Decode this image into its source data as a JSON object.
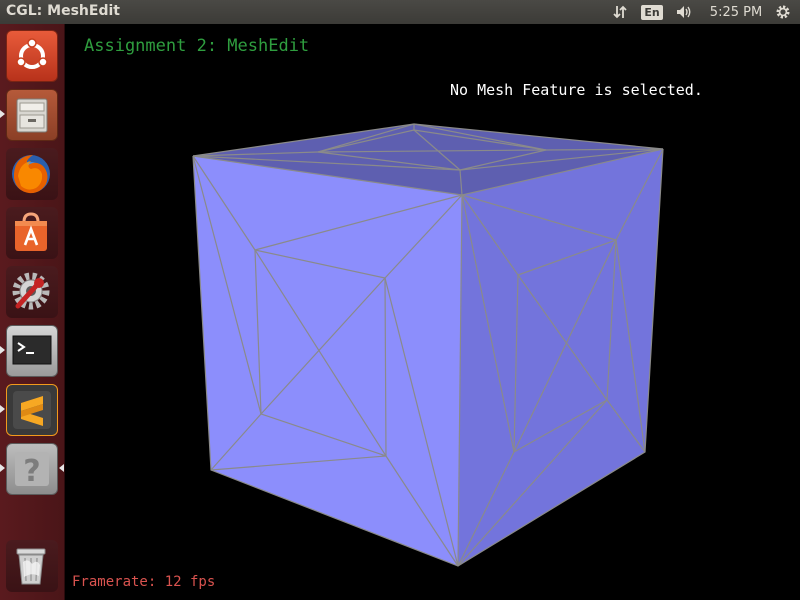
{
  "window": {
    "title": "CGL: MeshEdit"
  },
  "tray": {
    "network_icon": "network-transfer-icon",
    "language": "En",
    "volume_icon": "volume-icon",
    "clock": "5:25 PM",
    "settings_icon": "gear-icon"
  },
  "launcher": {
    "items": [
      {
        "name": "ubuntu-dash",
        "icon": "ubuntu-logo-icon",
        "running": false
      },
      {
        "name": "files",
        "icon": "file-cabinet-icon",
        "running": true
      },
      {
        "name": "firefox",
        "icon": "firefox-icon",
        "running": false
      },
      {
        "name": "software-center",
        "icon": "shopping-bag-icon",
        "running": false
      },
      {
        "name": "system-settings",
        "icon": "wrench-gear-icon",
        "running": false
      },
      {
        "name": "terminal",
        "icon": "terminal-icon",
        "running": true,
        "prompt": ">_"
      },
      {
        "name": "sublime-text",
        "icon": "sublime-icon",
        "running": true,
        "glyph": "S"
      },
      {
        "name": "unknown-app",
        "icon": "question-icon",
        "running": true,
        "active": true,
        "glyph": "?"
      },
      {
        "name": "trash",
        "icon": "trash-icon",
        "running": false
      }
    ]
  },
  "app": {
    "title": "Assignment 2: MeshEdit",
    "status": "No Mesh Feature is selected.",
    "framerate": "Framerate: 12 fps",
    "colors": {
      "title": "#2f9e3f",
      "status": "#ffffff",
      "framerate": "#d9534f",
      "mesh_top": "#5e5fb0",
      "mesh_left": "#8c8efc",
      "mesh_right": "#7374dc",
      "wireframe": "#8a8a8a"
    }
  }
}
